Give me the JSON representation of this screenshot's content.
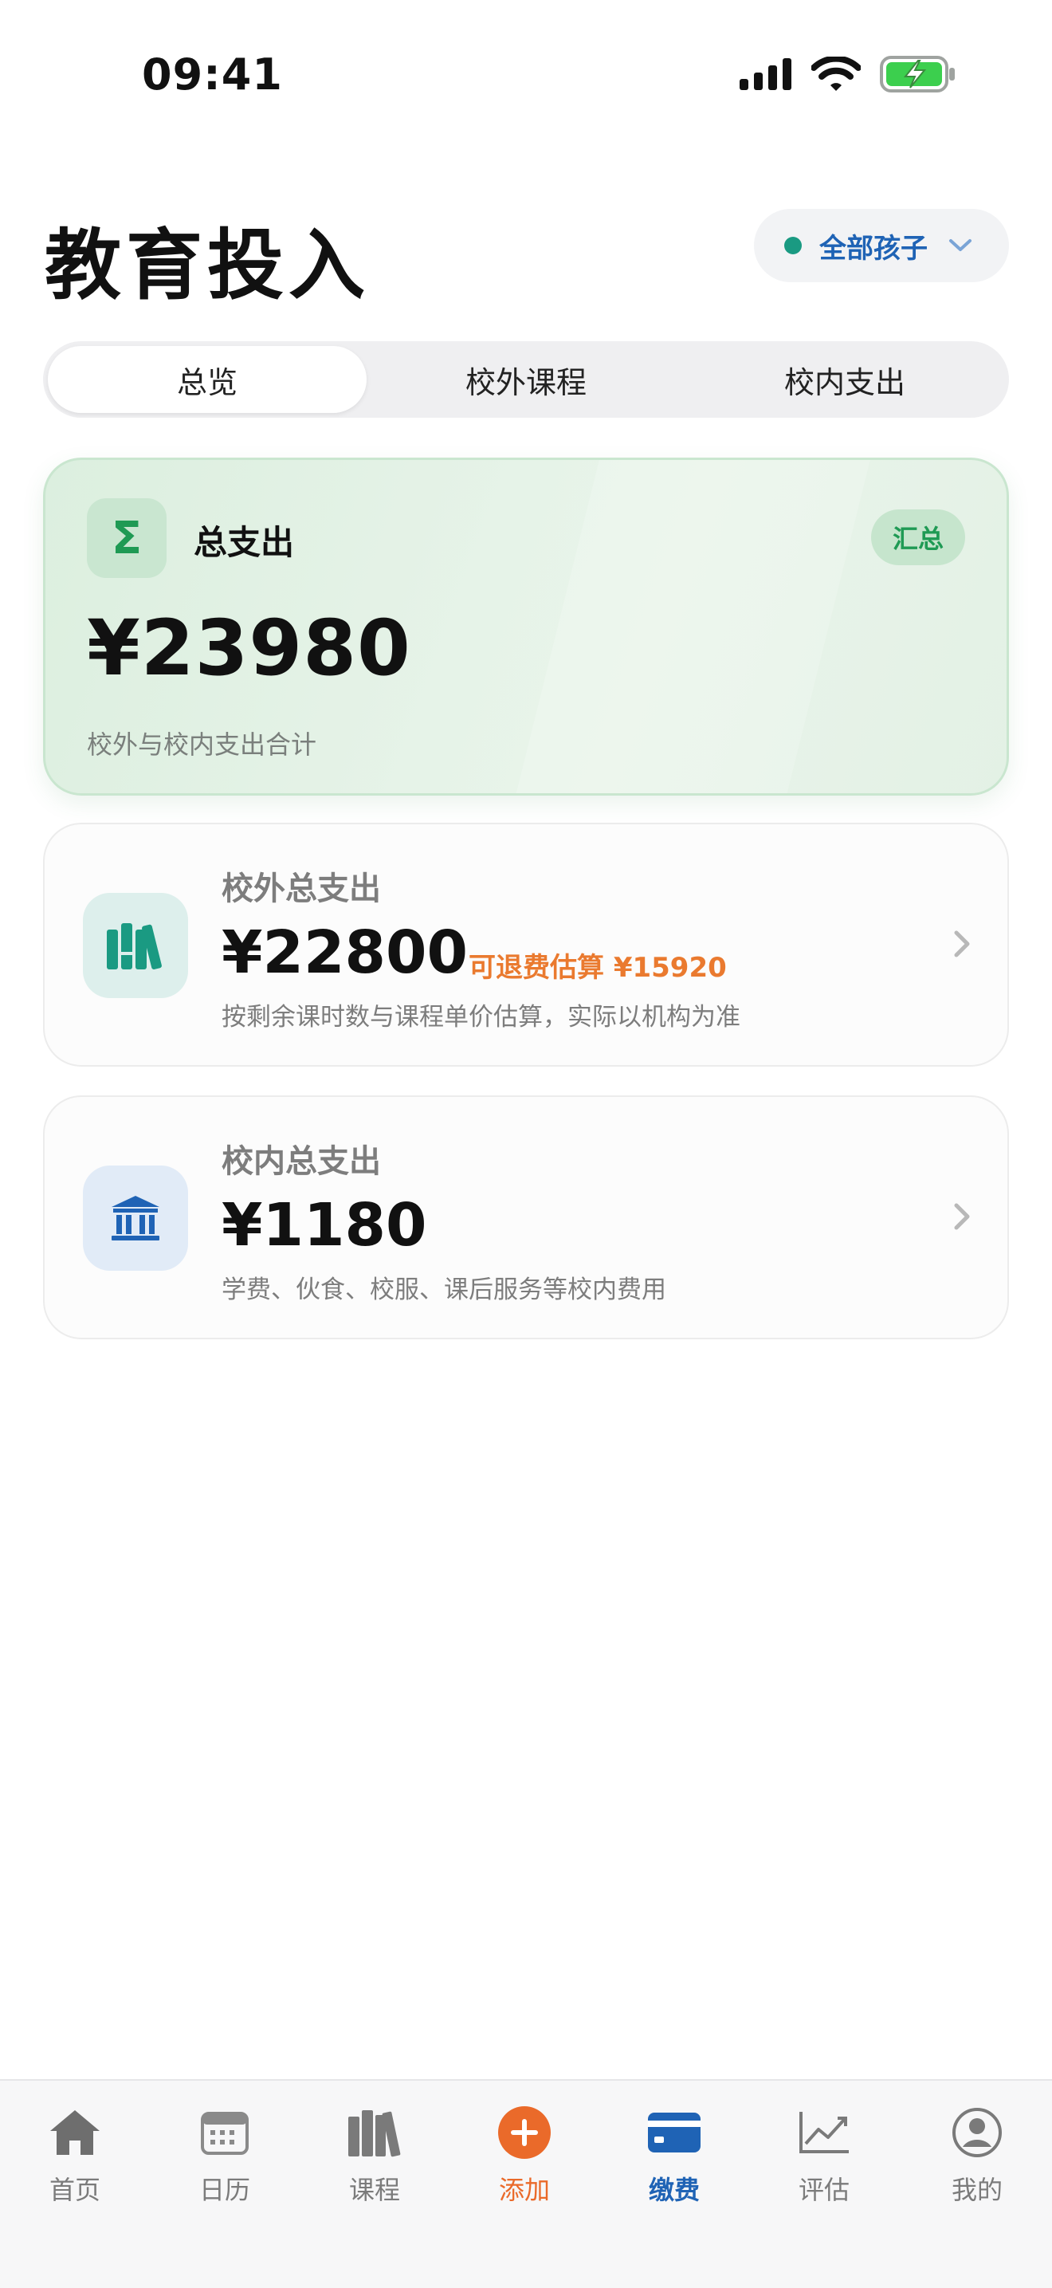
{
  "status_bar": {
    "time": "09:41"
  },
  "header": {
    "title": "教育投入",
    "child_selector": "全部孩子"
  },
  "tabs": [
    {
      "label": "总览",
      "active": true
    },
    {
      "label": "校外课程",
      "active": false
    },
    {
      "label": "校内支出",
      "active": false
    }
  ],
  "summary": {
    "icon_glyph": "Σ",
    "title": "总支出",
    "badge": "汇总",
    "amount": "¥23980",
    "subtitle": "校外与校内支出合计"
  },
  "cards": {
    "external": {
      "label": "校外总支出",
      "amount": "¥22800",
      "refund": "可退费估算 ¥15920",
      "description": "按剩余课时数与课程单价估算，实际以机构为准",
      "icon": "books-icon"
    },
    "internal": {
      "label": "校内总支出",
      "amount": "¥1180",
      "description": "学费、伙食、校服、课后服务等校内费用",
      "icon": "institution-icon"
    }
  },
  "tab_bar": {
    "home": "首页",
    "calendar": "日历",
    "courses": "课程",
    "add": "添加",
    "payment": "缴费",
    "evaluate": "评估",
    "mine": "我的",
    "active": "payment"
  },
  "colors": {
    "accent_blue": "#1f63b5",
    "accent_green": "#1f9a54",
    "accent_orange": "#ea7a2f",
    "teal": "#1a9a82"
  }
}
